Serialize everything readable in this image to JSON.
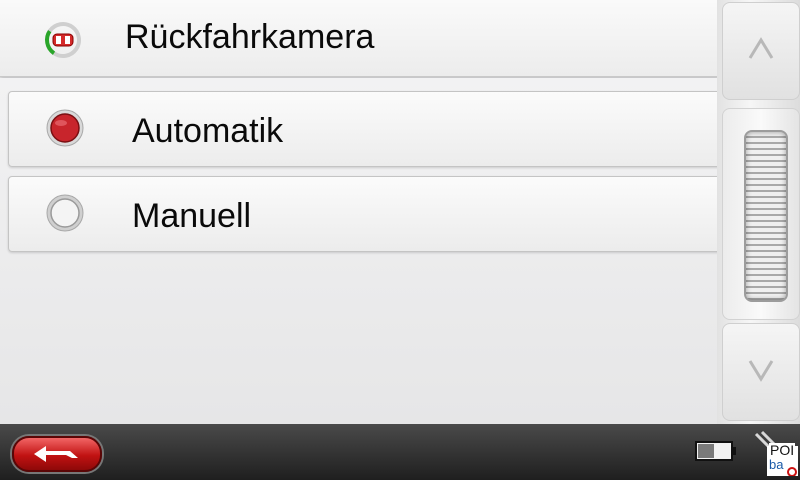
{
  "header": {
    "title": "Rückfahrkamera",
    "icon": "rear-camera-icon"
  },
  "options": [
    {
      "label": "Automatik",
      "selected": true
    },
    {
      "label": "Manuell",
      "selected": false
    }
  ],
  "scroll": {
    "up_icon": "chevron-up-icon",
    "down_icon": "chevron-down-icon"
  },
  "bottombar": {
    "back_icon": "back-arrow-icon",
    "battery_icon": "battery-icon",
    "poi_label": "POI",
    "poi_sub": "ba"
  },
  "colors": {
    "accent_red": "#c11212",
    "selected_radio": "#c8252c"
  }
}
